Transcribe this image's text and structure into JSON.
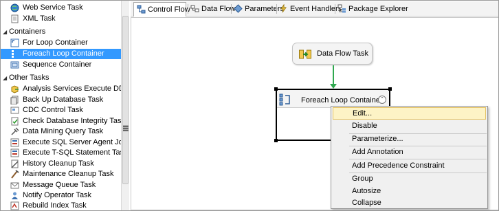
{
  "toolbox": {
    "items": [
      {
        "label": "Web Service Task",
        "icon": "globe-icon"
      },
      {
        "label": "XML Task",
        "icon": "xml-icon"
      }
    ],
    "containers_group": "Containers",
    "containers": [
      {
        "label": "For Loop Container",
        "icon": "for-loop-icon"
      },
      {
        "label": "Foreach Loop Container",
        "icon": "foreach-loop-icon",
        "selected": true
      },
      {
        "label": "Sequence Container",
        "icon": "sequence-icon"
      }
    ],
    "other_group": "Other Tasks",
    "other_tasks": [
      {
        "label": "Analysis Services Execute DDL T...",
        "icon": "cube-icon"
      },
      {
        "label": "Back Up Database Task",
        "icon": "backup-icon"
      },
      {
        "label": "CDC Control Task",
        "icon": "cdc-icon"
      },
      {
        "label": "Check Database Integrity Task",
        "icon": "check-integrity-icon"
      },
      {
        "label": "Data Mining Query Task",
        "icon": "mining-icon"
      },
      {
        "label": "Execute SQL Server Agent Job T...",
        "icon": "agent-job-icon"
      },
      {
        "label": "Execute T-SQL Statement Task",
        "icon": "tsql-icon"
      },
      {
        "label": "History Cleanup Task",
        "icon": "history-icon"
      },
      {
        "label": "Maintenance Cleanup Task",
        "icon": "maintenance-icon"
      },
      {
        "label": "Message Queue Task",
        "icon": "message-queue-icon"
      },
      {
        "label": "Notify Operator Task",
        "icon": "notify-icon"
      },
      {
        "label": "Rebuild Index Task",
        "icon": "rebuild-index-icon"
      }
    ]
  },
  "tabs": [
    {
      "label": "Control Flow",
      "active": true
    },
    {
      "label": "Data Flow"
    },
    {
      "label": "Parameters"
    },
    {
      "label": "Event Handlers"
    },
    {
      "label": "Package Explorer"
    }
  ],
  "canvas": {
    "data_flow_task": "Data Flow Task",
    "foreach_container": "Foreach Loop Container",
    "collapse_glyph": "⌃"
  },
  "context_menu": {
    "items": [
      "Edit...",
      "Disable",
      "Parameterize...",
      "Add Annotation",
      "Add Precedence Constraint",
      "Group",
      "Autosize",
      "Collapse"
    ],
    "highlighted": "Edit..."
  },
  "colors": {
    "selection": "#3399ff",
    "precedence_arrow": "#2fa84f",
    "menu_highlight": "#fdf3c6"
  }
}
